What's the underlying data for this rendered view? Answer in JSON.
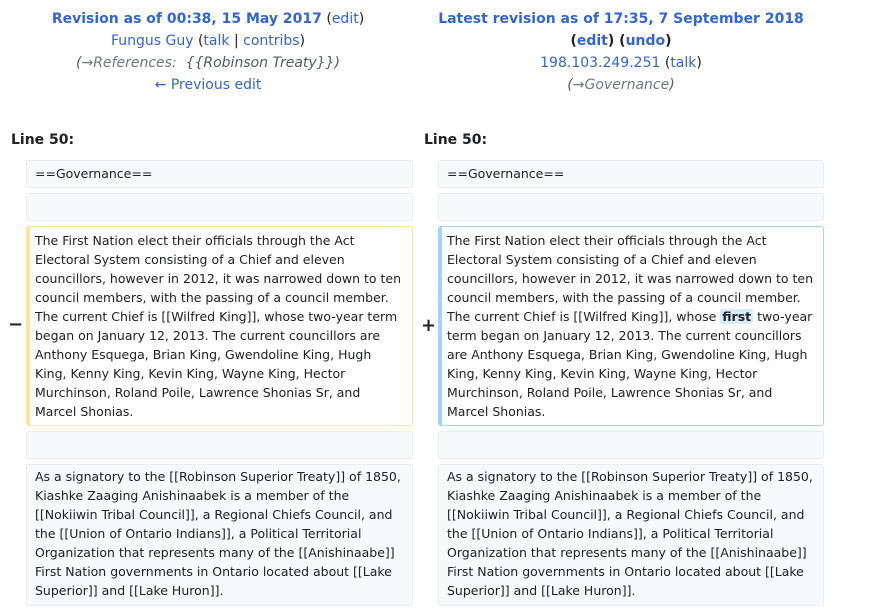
{
  "old_revision": {
    "title": "Revision as of 00:38, 15 May 2017",
    "edit_label": "edit",
    "user": "Fungus Guy",
    "talk_label": "talk",
    "contribs_label": "contribs",
    "comment_arrow": "→",
    "comment_section": "References:",
    "comment_text": "{{Robinson Treaty}}",
    "previous_edit_label": "← Previous edit",
    "line_label": "Line 50:"
  },
  "new_revision": {
    "title": "Latest revision as of 17:35, 7 September 2018",
    "edit_label": "edit",
    "undo_label": "undo",
    "user": "198.103.249.251",
    "talk_label": "talk",
    "comment_arrow": "→",
    "comment_section": "Governance",
    "line_label": "Line 50:"
  },
  "markers": {
    "deleted": "−",
    "added": "+"
  },
  "diff": {
    "heading": "==Governance==",
    "old_paragraph": "The First Nation elect their officials through the Act Electoral System consisting of a Chief and eleven councillors, however in 2012, it was narrowed down to ten council members, with the passing of a council member. The current Chief is [[Wilfred King]], whose two-year term began on January 12, 2013. The current councillors are Anthony Esquega, Brian King, Gwendoline King, Hugh King, Kenny King, Kevin King, Wayne King, Hector Murchinson, Roland Poile, Lawrence Shonias Sr, and Marcel Shonias.",
    "new_paragraph_before": "The First Nation elect their officials through the Act Electoral System consisting of a Chief and eleven councillors, however in 2012, it was narrowed down to ten council members, with the passing of a council member. The current Chief is [[Wilfred King]], whose",
    "new_paragraph_inserted": "first",
    "new_paragraph_after": "two-year term began on January 12, 2013. The current councillors are Anthony Esquega, Brian King, Gwendoline King, Hugh King, Kenny King, Kevin King, Wayne King, Hector Murchinson, Roland Poile, Lawrence Shonias Sr, and Marcel Shonias.",
    "signatory_paragraph": "As a signatory to the [[Robinson Superior Treaty]] of 1850, Kiashke Zaaging Anishinaabek is a member of the [[Nokiiwin Tribal Council]], a Regional Chiefs Council, and the [[Union of Ontario Indians]], a Political Territorial Organization that represents many of the [[Anishinaabe]] First Nation governments in Ontario located about [[Lake Superior]] and [[Lake Huron]]."
  }
}
